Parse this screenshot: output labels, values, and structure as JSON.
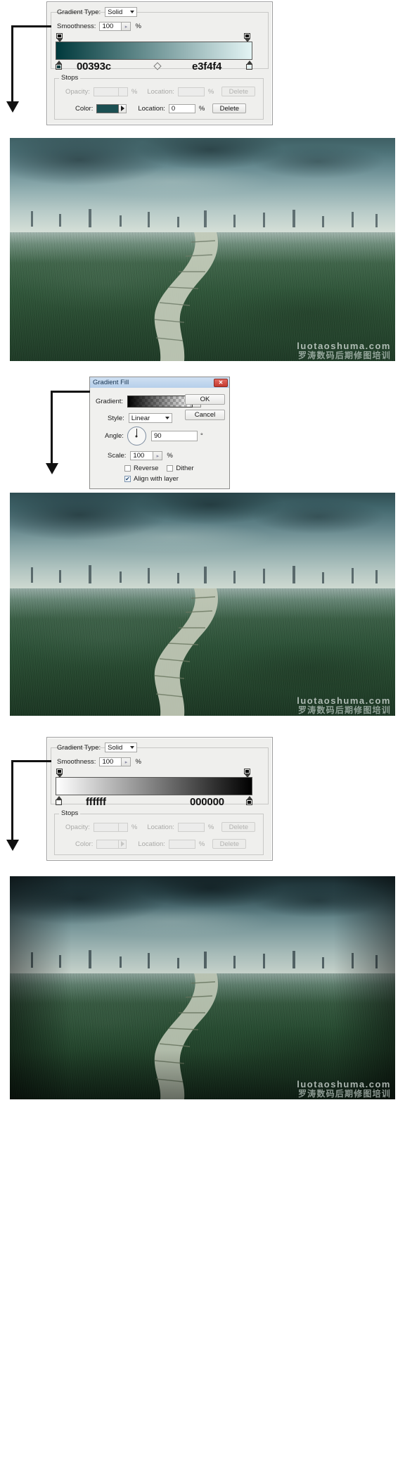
{
  "panels": {
    "gradient_editor_1": {
      "gradient_type_label": "Gradient Type:",
      "gradient_type_value": "Solid",
      "smoothness_label": "Smoothness:",
      "smoothness_value": "100",
      "percent": "%",
      "left_hex": "00393c",
      "right_hex": "e3f4f4",
      "stops_group": "Stops",
      "opacity_label": "Opacity:",
      "opacity_value": "",
      "location_label_1": "Location:",
      "location_value_1": "",
      "delete_label_1": "Delete",
      "color_label": "Color:",
      "location_label_2": "Location:",
      "location_value_2": "0",
      "delete_label_2": "Delete",
      "color_swatch": "#1b4f52",
      "grad_from": "#00393c",
      "grad_to": "#e3f4f4"
    },
    "gradient_fill_dialog": {
      "title": "Gradient Fill",
      "close_label": "✕",
      "gradient_label": "Gradient:",
      "style_label": "Style:",
      "style_value": "Linear",
      "angle_label": "Angle:",
      "angle_value": "90",
      "degree_symbol": "°",
      "scale_label": "Scale:",
      "scale_value": "100",
      "percent": "%",
      "reverse_label": "Reverse",
      "reverse_checked": false,
      "dither_label": "Dither",
      "dither_checked": false,
      "align_label": "Align with layer",
      "align_checked": true,
      "ok_label": "OK",
      "cancel_label": "Cancel"
    },
    "gradient_editor_2": {
      "gradient_type_label": "Gradient Type:",
      "gradient_type_value": "Solid",
      "smoothness_label": "Smoothness:",
      "smoothness_value": "100",
      "percent": "%",
      "left_hex": "ffffff",
      "right_hex": "000000",
      "stops_group": "Stops",
      "opacity_label": "Opacity:",
      "opacity_value": "",
      "location_label_1": "Location:",
      "location_value_1": "",
      "delete_label_1": "Delete",
      "color_label": "Color:",
      "location_label_2": "Location:",
      "location_value_2": "",
      "delete_label_2": "Delete",
      "grad_from": "#ffffff",
      "grad_to": "#000000"
    }
  },
  "photos": {
    "watermark_en": "luotaoshuma.com",
    "watermark_cn": "罗涛数码后期修图培训",
    "alt_1": "grassy field with winding stone path under stormy teal sky",
    "alt_2": "grassy field with winding stone path under stormy teal sky",
    "alt_3": "grassy field with winding stone path under stormy teal sky, darkened edges"
  }
}
